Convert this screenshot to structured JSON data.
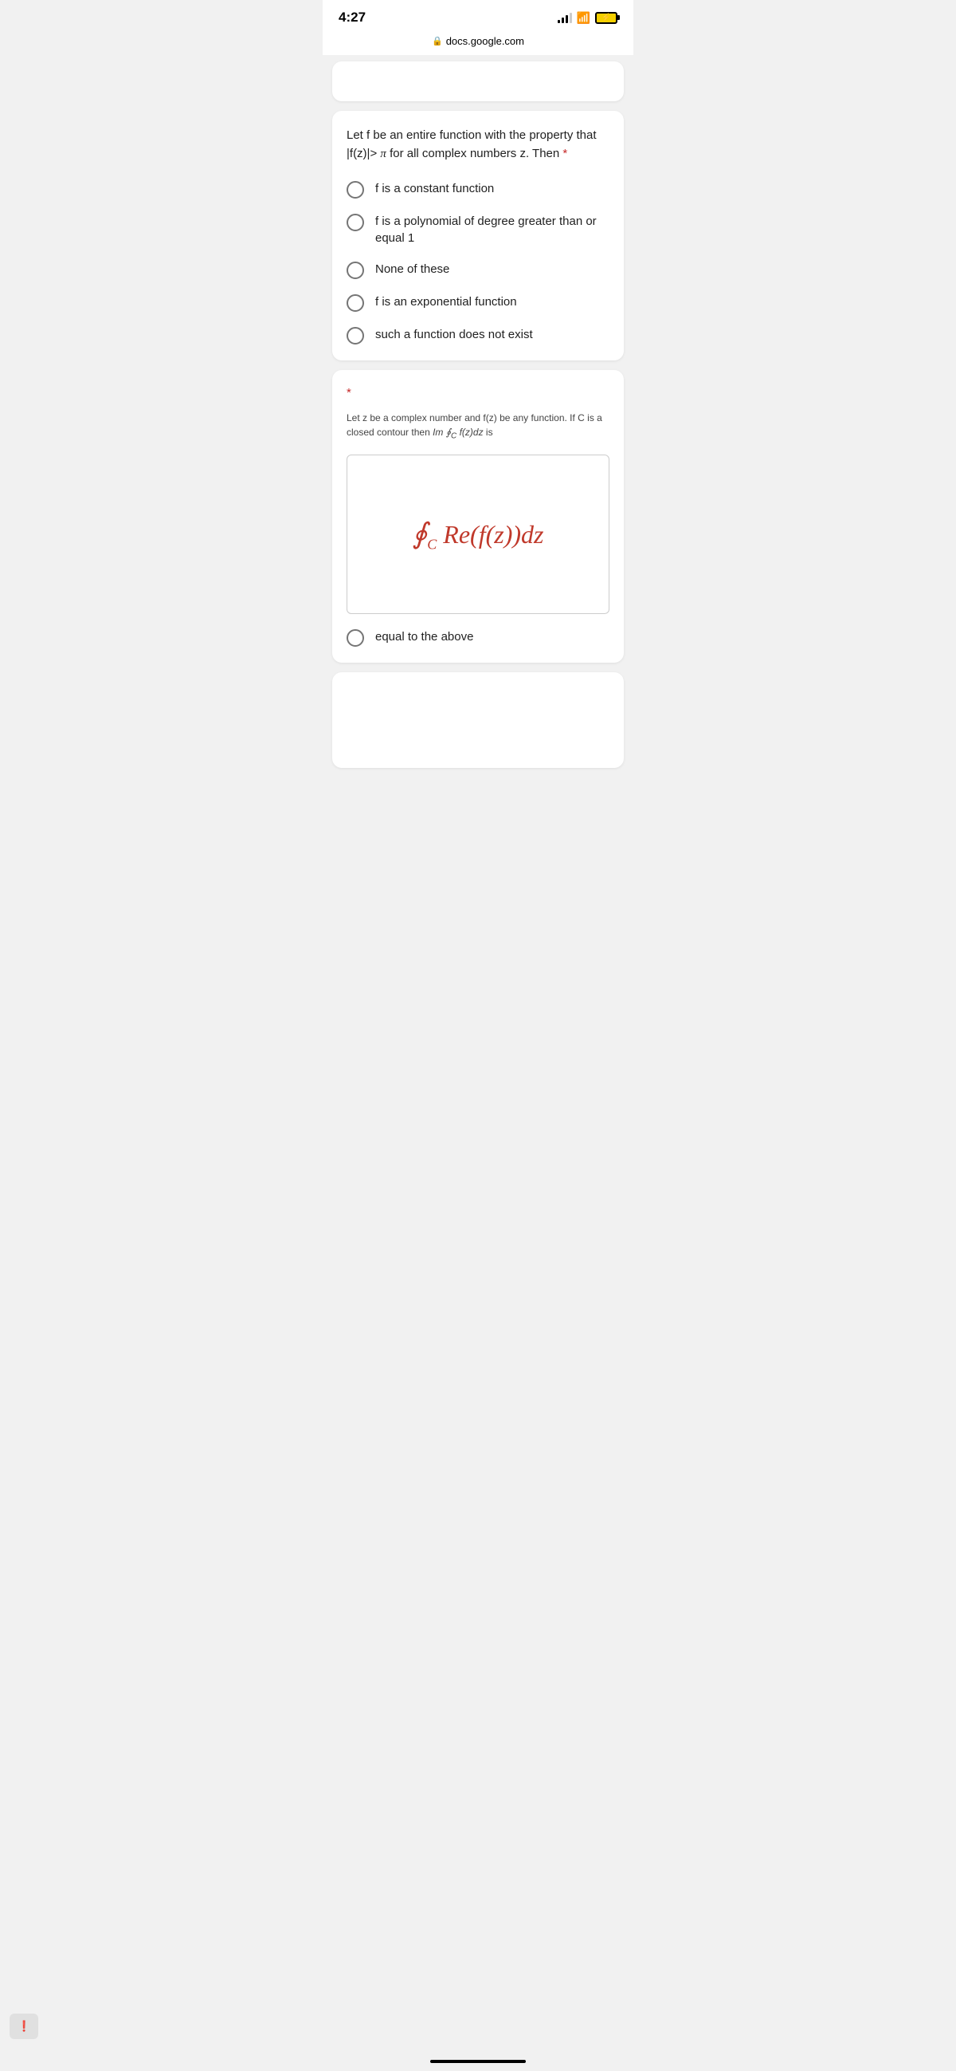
{
  "statusBar": {
    "time": "4:27",
    "url": "docs.google.com"
  },
  "topPartialCard": {
    "visible": true
  },
  "question1": {
    "text": "Let f be an entire function with the property that |f(z)|> π for all complex numbers z. Then",
    "required": "*",
    "options": [
      {
        "id": "opt1",
        "label": "f is a constant function"
      },
      {
        "id": "opt2",
        "label": "f is a polynomial of degree greater than or equal 1"
      },
      {
        "id": "opt3",
        "label": "None of these"
      },
      {
        "id": "opt4",
        "label": "f is an exponential function"
      },
      {
        "id": "opt5",
        "label": "such a function does not exist"
      }
    ]
  },
  "question2": {
    "required": "*",
    "subText": "Let z be a complex number and f(z) be any function. If C is a closed contour then Im ∮_C f(z)dz is",
    "formulaText": "∮_C Re(f(z))dz",
    "formulaDisplay": "ϕ",
    "options": [
      {
        "id": "opt_eq",
        "label": "equal to the above"
      }
    ]
  },
  "feedbackButton": {
    "label": "!"
  }
}
